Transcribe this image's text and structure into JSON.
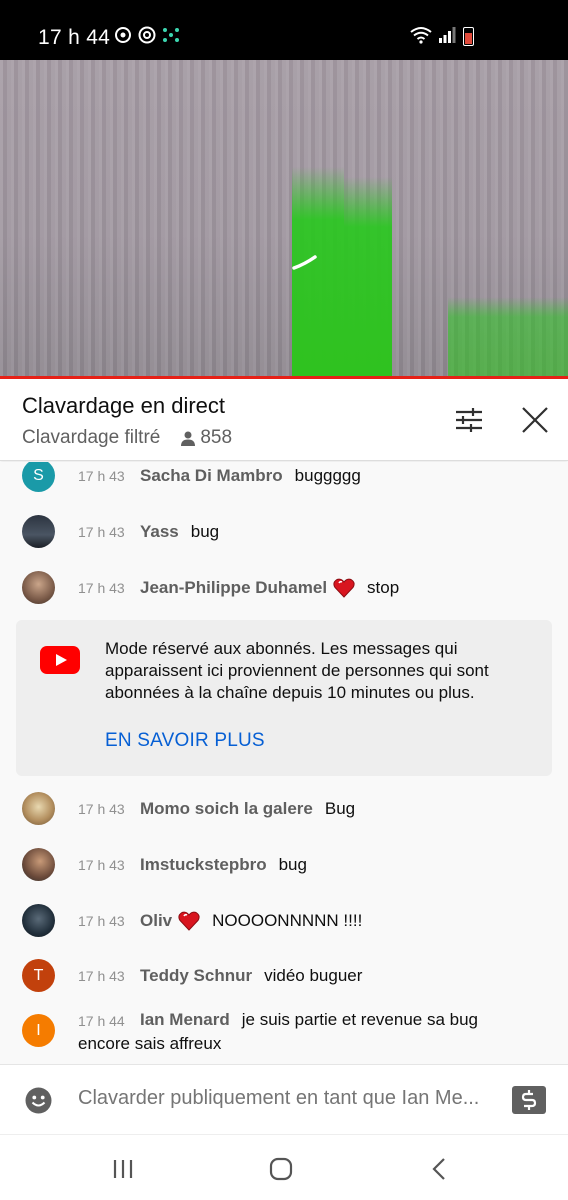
{
  "status_bar": {
    "time": "17 h 44"
  },
  "chat": {
    "title": "Clavardage en direct",
    "filter_label": "Clavardage filtré",
    "viewer_count": "858",
    "messages": [
      {
        "time": "17 h 43",
        "author": "Sacha Di Mambro",
        "text": "buggggg",
        "avatar_letter": "S",
        "avatar_color": "#1a9aa8"
      },
      {
        "time": "17 h 43",
        "author": "Yass",
        "text": "bug"
      },
      {
        "time": "17 h 43",
        "author": "Jean-Philippe Duhamel",
        "text": "stop"
      },
      {
        "time": "17 h 43",
        "author": "Momo soich la galere",
        "text": "Bug"
      },
      {
        "time": "17 h 43",
        "author": "Imstuckstepbro",
        "text": "bug"
      },
      {
        "time": "17 h 43",
        "author": "Oliv",
        "text": "NOOOONNNNN !!!!"
      },
      {
        "time": "17 h 43",
        "author": "Teddy Schnur",
        "text": "vidéo buguer",
        "avatar_letter": "T",
        "avatar_color": "#c2410c"
      },
      {
        "time": "17 h 44",
        "author": "Ian Menard",
        "text": "je suis partie et revenue sa bug",
        "text_line2": "encore sais affreux",
        "avatar_letter": "I",
        "avatar_color": "#f57c00"
      }
    ],
    "notice": {
      "text": "Mode réservé aux abonnés. Les messages qui apparaissent ici proviennent de personnes qui sont abonnées à la chaîne depuis 10 minutes ou plus.",
      "link_label": "EN SAVOIR PLUS"
    },
    "input_placeholder": "Clavarder publiquement en tant que Ian Me..."
  },
  "colors": {
    "accent_red": "#e62117",
    "link_blue": "#065fd4"
  }
}
